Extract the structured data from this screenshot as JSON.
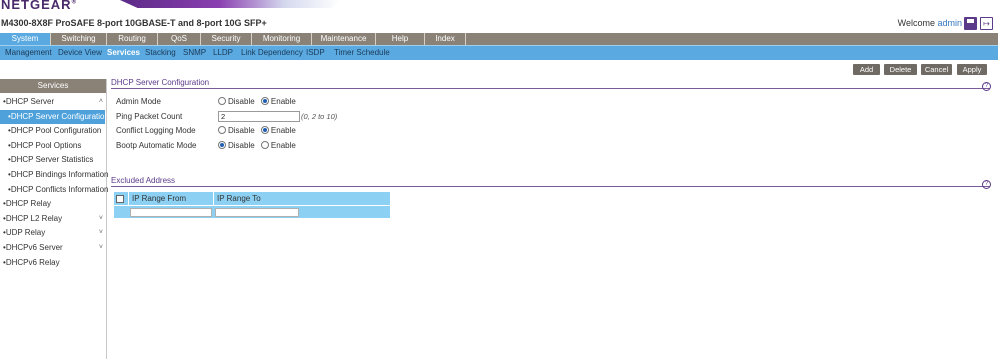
{
  "header": {
    "brand": "NETGEAR",
    "brand_mark": "®",
    "product_title": "M4300-8X8F ProSAFE 8-port 10GBASE-T and 8-port 10G SFP+",
    "welcome_label": "Welcome",
    "username": "admin",
    "save_icon": "save-icon",
    "logout_icon": "logout-icon"
  },
  "top_nav": {
    "tabs": [
      "System",
      "Switching",
      "Routing",
      "QoS",
      "Security",
      "Monitoring",
      "Maintenance",
      "Help",
      "Index"
    ],
    "active": "System"
  },
  "sub_nav": {
    "items": [
      "Management",
      "Device View",
      "Services",
      "Stacking",
      "SNMP",
      "LLDP",
      "Link Dependency",
      "ISDP",
      "Timer Schedule"
    ],
    "active": "Services"
  },
  "sidebar": {
    "title": "Services",
    "items": [
      {
        "label": "DHCP Server",
        "level": 0,
        "expanded": true
      },
      {
        "label": "DHCP Server Configuration",
        "level": 1,
        "active": true
      },
      {
        "label": "DHCP Pool Configuration",
        "level": 1
      },
      {
        "label": "DHCP Pool Options",
        "level": 1
      },
      {
        "label": "DHCP Server Statistics",
        "level": 1
      },
      {
        "label": "DHCP Bindings Information",
        "level": 1
      },
      {
        "label": "DHCP Conflicts Information",
        "level": 1
      },
      {
        "label": "DHCP Relay",
        "level": 0
      },
      {
        "label": "DHCP L2 Relay",
        "level": 0,
        "collapsed": true
      },
      {
        "label": "UDP Relay",
        "level": 0,
        "collapsed": true
      },
      {
        "label": "DHCPv6 Server",
        "level": 0,
        "collapsed": true
      },
      {
        "label": "DHCPv6 Relay",
        "level": 0
      }
    ]
  },
  "actions": {
    "add": "Add",
    "delete": "Delete",
    "cancel": "Cancel",
    "apply": "Apply"
  },
  "dhcp_config": {
    "section_title": "DHCP Server Configuration",
    "admin_mode": {
      "label": "Admin Mode",
      "options": [
        "Disable",
        "Enable"
      ],
      "selected": "Enable"
    },
    "ping_packet_count": {
      "label": "Ping Packet Count",
      "value": "2",
      "hint": "(0, 2 to 10)"
    },
    "conflict_logging_mode": {
      "label": "Conflict Logging Mode",
      "options": [
        "Disable",
        "Enable"
      ],
      "selected": "Enable"
    },
    "bootp_automatic_mode": {
      "label": "Bootp Automatic Mode",
      "options": [
        "Disable",
        "Enable"
      ],
      "selected": "Disable"
    }
  },
  "excluded_address": {
    "section_title": "Excluded Address",
    "columns": [
      "IP Range From",
      "IP Range To"
    ],
    "new_row": {
      "from": "",
      "to": ""
    }
  },
  "help_icon": "?",
  "colors": {
    "nav_bg": "#8a8277",
    "active_blue": "#5aa9e0",
    "section_purple": "#5b3a8a",
    "table_blue": "#8cd0f3",
    "button_gray": "#6f6a64"
  }
}
